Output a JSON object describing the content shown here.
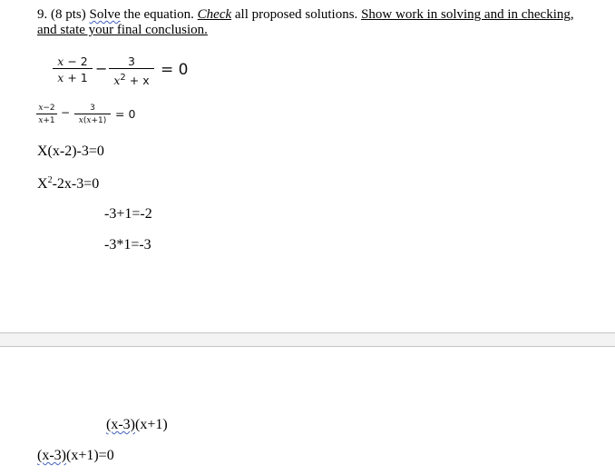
{
  "question": {
    "number": "9.",
    "points": "(8 pts)",
    "solve": "Solve",
    "text1": " the equation. ",
    "check": "Check",
    "text2": " all proposed solutions. ",
    "show_work": "Show work in solving and in checking,",
    "line2": "and state your final conclusion."
  },
  "equation_large": {
    "frac1_num": "x − 2",
    "frac1_den": "x + 1",
    "minus": "−",
    "frac2_num": "3",
    "frac2_den_base": "x",
    "frac2_den_exp": "2",
    "frac2_den_rest": " + x",
    "equals": "= 0"
  },
  "equation_small": {
    "frac1_num": "x−2",
    "frac1_den": "x+1",
    "minus": "−",
    "frac2_num": "3",
    "frac2_den": "x(x+1)",
    "equals": "= 0"
  },
  "work": {
    "line1": "X(x-2)-3=0",
    "line2_base": "X",
    "line2_exp": "2",
    "line2_rest": "-2x-3=0",
    "sum_line": "-3+1=-2",
    "product_line": "-3*1=-3"
  },
  "factoring": {
    "factored": "(x-3)(x+1)",
    "factored_a": "(x-3)",
    "factored_b": "(x+1)",
    "factored_eq_a": "(x-3)",
    "factored_eq_b": "(x+1)=0"
  }
}
